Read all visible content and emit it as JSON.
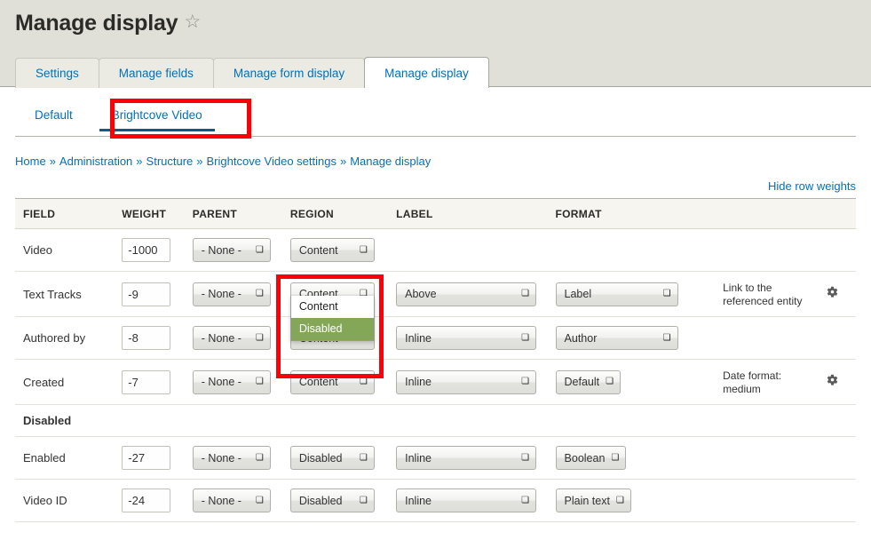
{
  "page": {
    "title": "Manage display",
    "star_icon": "☆"
  },
  "primary_tabs": [
    {
      "label": "Settings",
      "active": false
    },
    {
      "label": "Manage fields",
      "active": false
    },
    {
      "label": "Manage form display",
      "active": false
    },
    {
      "label": "Manage display",
      "active": true
    }
  ],
  "secondary_tabs": [
    {
      "label": "Default",
      "active": false
    },
    {
      "label": "Brightcove Video",
      "active": true
    }
  ],
  "breadcrumb": {
    "items": [
      "Home",
      "Administration",
      "Structure",
      "Brightcove Video settings",
      "Manage display"
    ],
    "separator": "»"
  },
  "actions": {
    "hide_row_weights": "Hide row weights"
  },
  "table": {
    "headers": [
      "FIELD",
      "WEIGHT",
      "PARENT",
      "REGION",
      "LABEL",
      "FORMAT",
      "",
      ""
    ],
    "rows": [
      {
        "type": "field",
        "field": "Video",
        "weight": "-1000",
        "parent": "- None -",
        "region": "Content",
        "label": "",
        "format": "",
        "summary": "",
        "gear": false,
        "highlight": false,
        "dropdown_open": false
      },
      {
        "type": "field",
        "field": "Text Tracks",
        "weight": "-9",
        "parent": "- None -",
        "region": "Content",
        "label": "Above",
        "format": "Label",
        "summary": "Link to the referenced entity",
        "gear": true,
        "highlight": true,
        "dropdown_open": true,
        "dropdown_options": [
          {
            "label": "Content",
            "selected": false
          },
          {
            "label": "Disabled",
            "selected": true
          }
        ]
      },
      {
        "type": "field",
        "field": "Authored by",
        "weight": "-8",
        "parent": "- None -",
        "region": "Content",
        "label": "Inline",
        "format": "Author",
        "summary": "",
        "gear": false,
        "highlight": false,
        "dropdown_open": false
      },
      {
        "type": "field",
        "field": "Created",
        "weight": "-7",
        "parent": "- None -",
        "region": "Content",
        "label": "Inline",
        "format": "Default",
        "summary": "Date format: medium",
        "gear": true,
        "highlight": false,
        "dropdown_open": false
      },
      {
        "type": "region",
        "field": "Disabled"
      },
      {
        "type": "field",
        "field": "Enabled",
        "weight": "-27",
        "parent": "- None -",
        "region": "Disabled",
        "label": "Inline",
        "format": "Boolean",
        "summary": "",
        "gear": false,
        "highlight": false,
        "dropdown_open": false
      },
      {
        "type": "field",
        "field": "Video ID",
        "weight": "-24",
        "parent": "- None -",
        "region": "Disabled",
        "label": "Inline",
        "format": "Plain text",
        "summary": "",
        "gear": false,
        "highlight": false,
        "dropdown_open": false
      }
    ]
  },
  "colors": {
    "link": "#0071b8",
    "top_band": "#e0e0d8",
    "active_tab_underline": "#0f5a8c",
    "annotation_red": "#fb0007",
    "dropdown_selected": "#84a757",
    "row_highlight": "#f3fafd"
  }
}
